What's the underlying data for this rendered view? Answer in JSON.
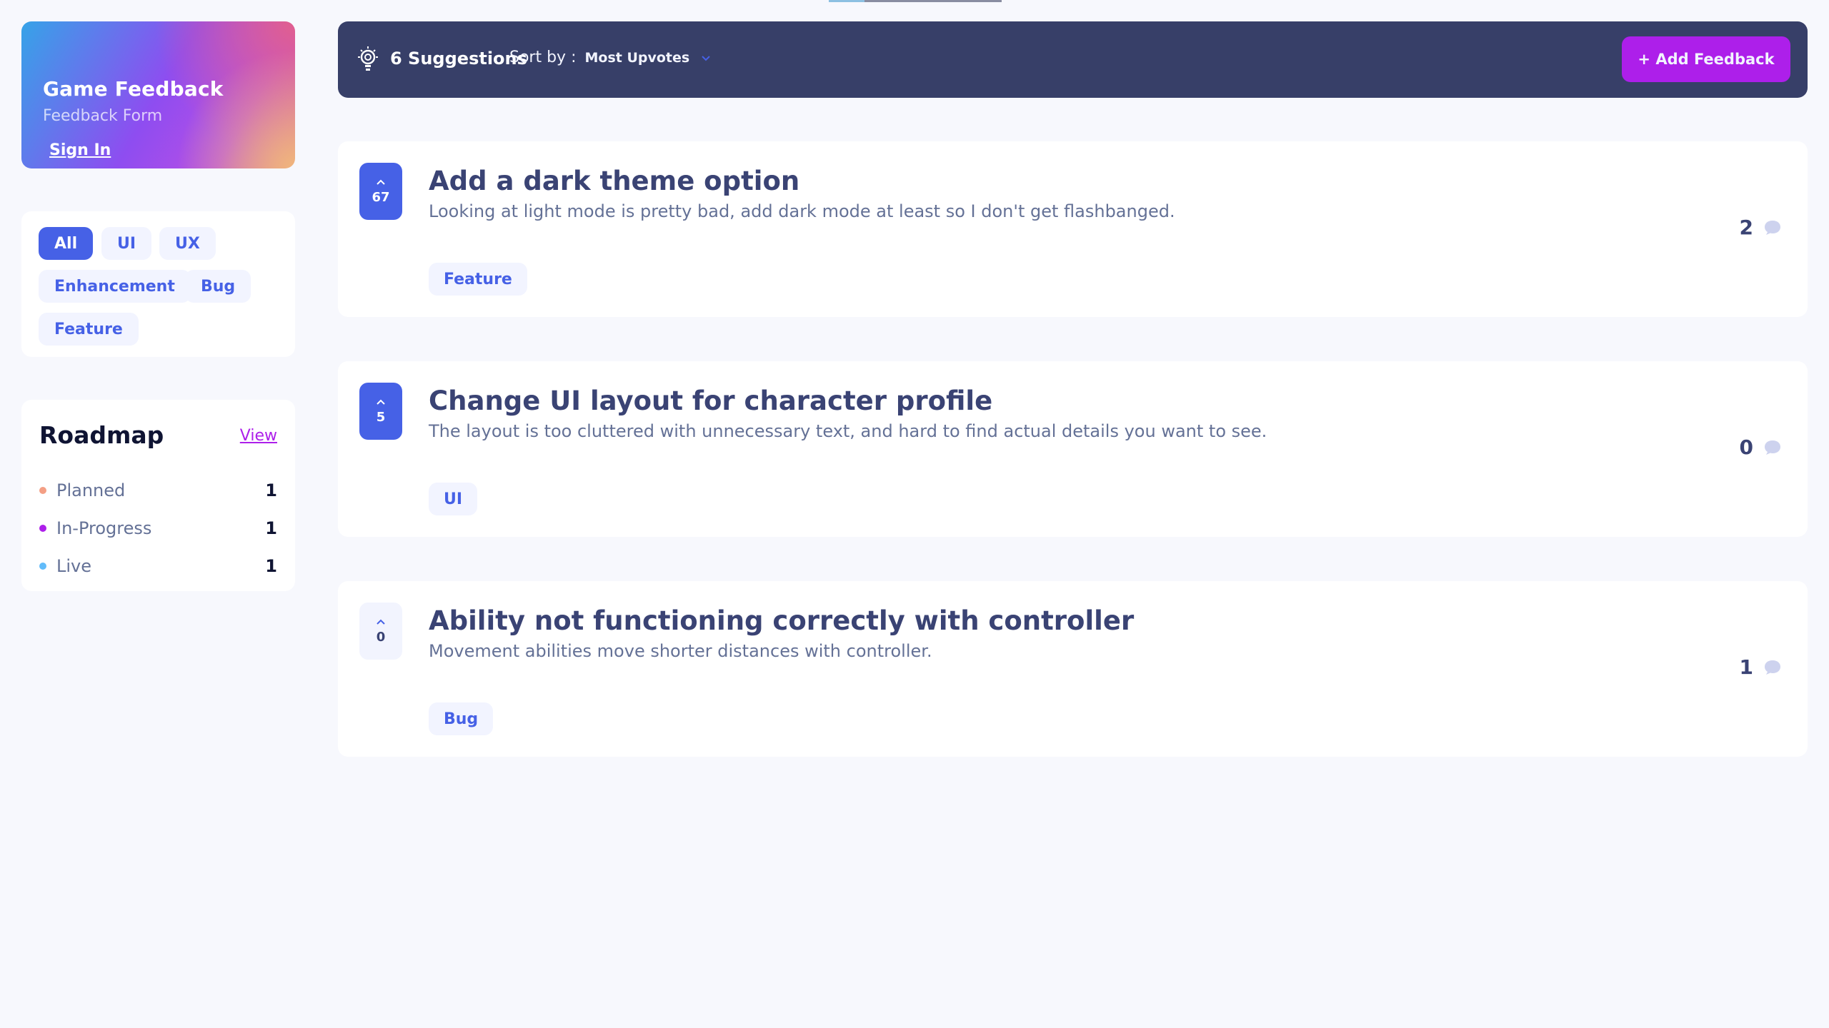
{
  "sidebar": {
    "brand": {
      "title": "Game Feedback",
      "subtitle": "Feedback Form",
      "signin": "Sign In"
    },
    "filters": [
      "All",
      "UI",
      "UX",
      "Enhancement",
      "Bug",
      "Feature"
    ],
    "active_filter": "All",
    "roadmap": {
      "title": "Roadmap",
      "view_label": "View",
      "items": [
        {
          "label": "Planned",
          "count": "1",
          "color": "#F49F85"
        },
        {
          "label": "In-Progress",
          "count": "1",
          "color": "#AD1FEA"
        },
        {
          "label": "Live",
          "count": "1",
          "color": "#62BCFA"
        }
      ]
    }
  },
  "topbar": {
    "suggestions": "6 Suggestions",
    "sort_label": "Sort by :",
    "sort_value": "Most Upvotes",
    "add_button": "+ Add Feedback"
  },
  "feedback": [
    {
      "votes": "67",
      "title": "Add a dark theme option",
      "description": "Looking at light mode is pretty bad, add dark mode at least so I don't get flashbanged.",
      "tag": "Feature",
      "comments": "2",
      "upvoted": true
    },
    {
      "votes": "5",
      "title": "Change UI layout for character profile",
      "description": "The layout is too cluttered with unnecessary text, and hard to find actual details you want to see.",
      "tag": "UI",
      "comments": "0",
      "upvoted": true
    },
    {
      "votes": "0",
      "title": "Ability not functioning correctly with controller",
      "description": "Movement abilities move shorter distances with controller.",
      "tag": "Bug",
      "comments": "1",
      "upvoted": false
    }
  ],
  "colors": {
    "accent_purple": "#AD1FEA",
    "accent_blue": "#4661E6",
    "navy": "#373F68",
    "background": "#F7F8FD"
  }
}
